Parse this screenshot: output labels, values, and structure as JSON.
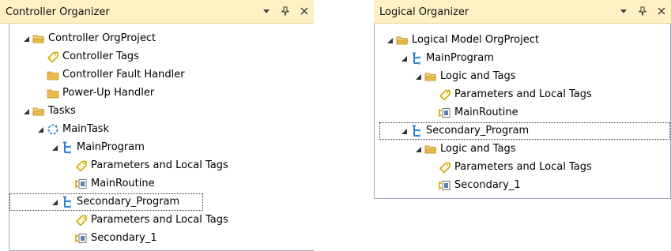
{
  "left": {
    "title": "Controller Organizer",
    "items": [
      {
        "label": "Controller OrgProject",
        "icon": "folder-open-icon",
        "expander": "expanded"
      },
      {
        "label": "Controller Tags",
        "icon": "tag-icon",
        "expander": "none"
      },
      {
        "label": "Controller Fault Handler",
        "icon": "folder-icon",
        "expander": "none"
      },
      {
        "label": "Power-Up Handler",
        "icon": "folder-icon",
        "expander": "none"
      },
      {
        "label": "Tasks",
        "icon": "folder-open-icon",
        "expander": "expanded"
      },
      {
        "label": "MainTask",
        "icon": "task-cycle-icon",
        "expander": "expanded"
      },
      {
        "label": "MainProgram",
        "icon": "program-icon",
        "expander": "expanded"
      },
      {
        "label": "Parameters and Local Tags",
        "icon": "tag-icon",
        "expander": "none"
      },
      {
        "label": "MainRoutine",
        "icon": "routine-icon",
        "expander": "none"
      },
      {
        "label": "Secondary_Program",
        "icon": "program-icon",
        "expander": "expanded",
        "selected": true
      },
      {
        "label": "Parameters and Local Tags",
        "icon": "tag-icon",
        "expander": "none"
      },
      {
        "label": "Secondary_1",
        "icon": "routine-icon",
        "expander": "none"
      }
    ]
  },
  "right": {
    "title": "Logical Organizer",
    "items": [
      {
        "label": "Logical Model OrgProject",
        "icon": "folder-open-icon",
        "expander": "expanded"
      },
      {
        "label": "MainProgram",
        "icon": "program-icon",
        "expander": "expanded"
      },
      {
        "label": "Logic and Tags",
        "icon": "folder-open-icon",
        "expander": "expanded"
      },
      {
        "label": "Parameters and Local Tags",
        "icon": "tag-icon",
        "expander": "none"
      },
      {
        "label": "MainRoutine",
        "icon": "routine-icon",
        "expander": "none"
      },
      {
        "label": "Secondary_Program",
        "icon": "program-icon",
        "expander": "expanded",
        "selected": true
      },
      {
        "label": "Logic and Tags",
        "icon": "folder-open-icon",
        "expander": "expanded"
      },
      {
        "label": "Parameters and Local Tags",
        "icon": "tag-icon",
        "expander": "none"
      },
      {
        "label": "Secondary_1",
        "icon": "routine-icon",
        "expander": "none"
      }
    ]
  },
  "titlebar_icons": [
    "dropdown-arrow-icon",
    "pin-icon",
    "close-icon"
  ],
  "colors": {
    "titlebar": "#fff1c4",
    "folder": "#e8b84a",
    "tag": "#c9a400",
    "program": "#2f7fd6",
    "routine": "#d9a300",
    "task": "#3a8fd8"
  }
}
